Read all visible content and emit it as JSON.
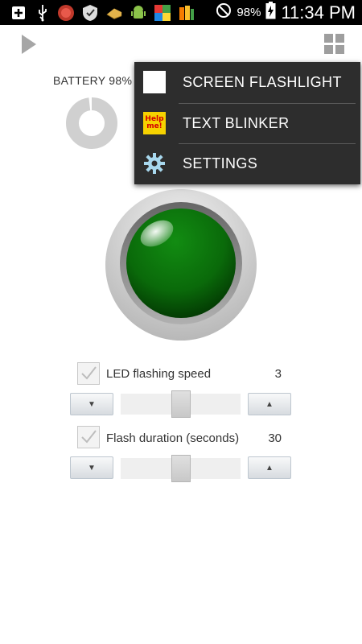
{
  "status_bar": {
    "battery_percent": "98%",
    "time": "11:34 PM"
  },
  "header": {
    "battery_label": "BATTERY 98%",
    "battery_level": 0.98
  },
  "menu": {
    "items": [
      {
        "label": "SCREEN FLASHLIGHT",
        "icon": "white-square-icon"
      },
      {
        "label": "TEXT BLINKER",
        "icon": "help-me-icon",
        "icon_text": "Help me!"
      },
      {
        "label": "SETTINGS",
        "icon": "gear-icon"
      }
    ]
  },
  "led": {
    "color": "#0b6e0b",
    "state": "on"
  },
  "controls": {
    "speed": {
      "label": "LED flashing speed",
      "value": "3",
      "checked": true,
      "level": 0.5
    },
    "duration": {
      "label": "Flash duration (seconds)",
      "value": "30",
      "checked": true,
      "level": 0.5
    }
  },
  "colors": {
    "statusbar": "#000000",
    "menu_bg": "#2d2d2d",
    "accent": "#33b5e5"
  }
}
